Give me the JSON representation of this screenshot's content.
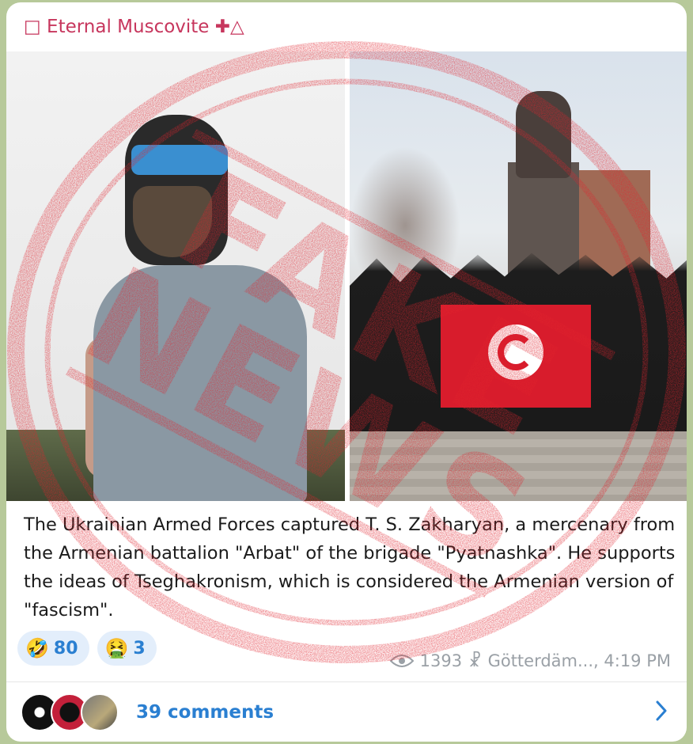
{
  "channel": {
    "name": "\u0000 Eternal Muscovite",
    "name_display": " Eternal Muscovite",
    "symbols": "✚△",
    "prefix_glyph": "□"
  },
  "post": {
    "caption": "The Ukrainian Armed Forces captured T. S. Zakharyan, a mercenary from the Armenian battalion \"Arbat\" of the brigade \"Pyatnashka\". He supports the ideas of Tseghakronism, which is considered the Armenian version of \"fascism\".",
    "stamp_text_top": "FAKE",
    "stamp_text_bottom": "NEWS",
    "reactions": [
      {
        "emoji": "🤣",
        "count": "80"
      },
      {
        "emoji": "🤮",
        "count": "3"
      }
    ],
    "views": "1393",
    "author": "Götterdäm...",
    "time": "4:19 PM",
    "meta_line": "Götterdäm..., 4:19 PM"
  },
  "comments": {
    "label": "39 comments"
  },
  "colors": {
    "accent": "#2a7fd1",
    "channel_name": "#c7365d",
    "stamp": "#e0242e",
    "reaction_bg": "#e3eefb"
  },
  "icons": {
    "views": "eye-icon",
    "author": "author-mark-icon",
    "chevron": "chevron-right-icon"
  }
}
